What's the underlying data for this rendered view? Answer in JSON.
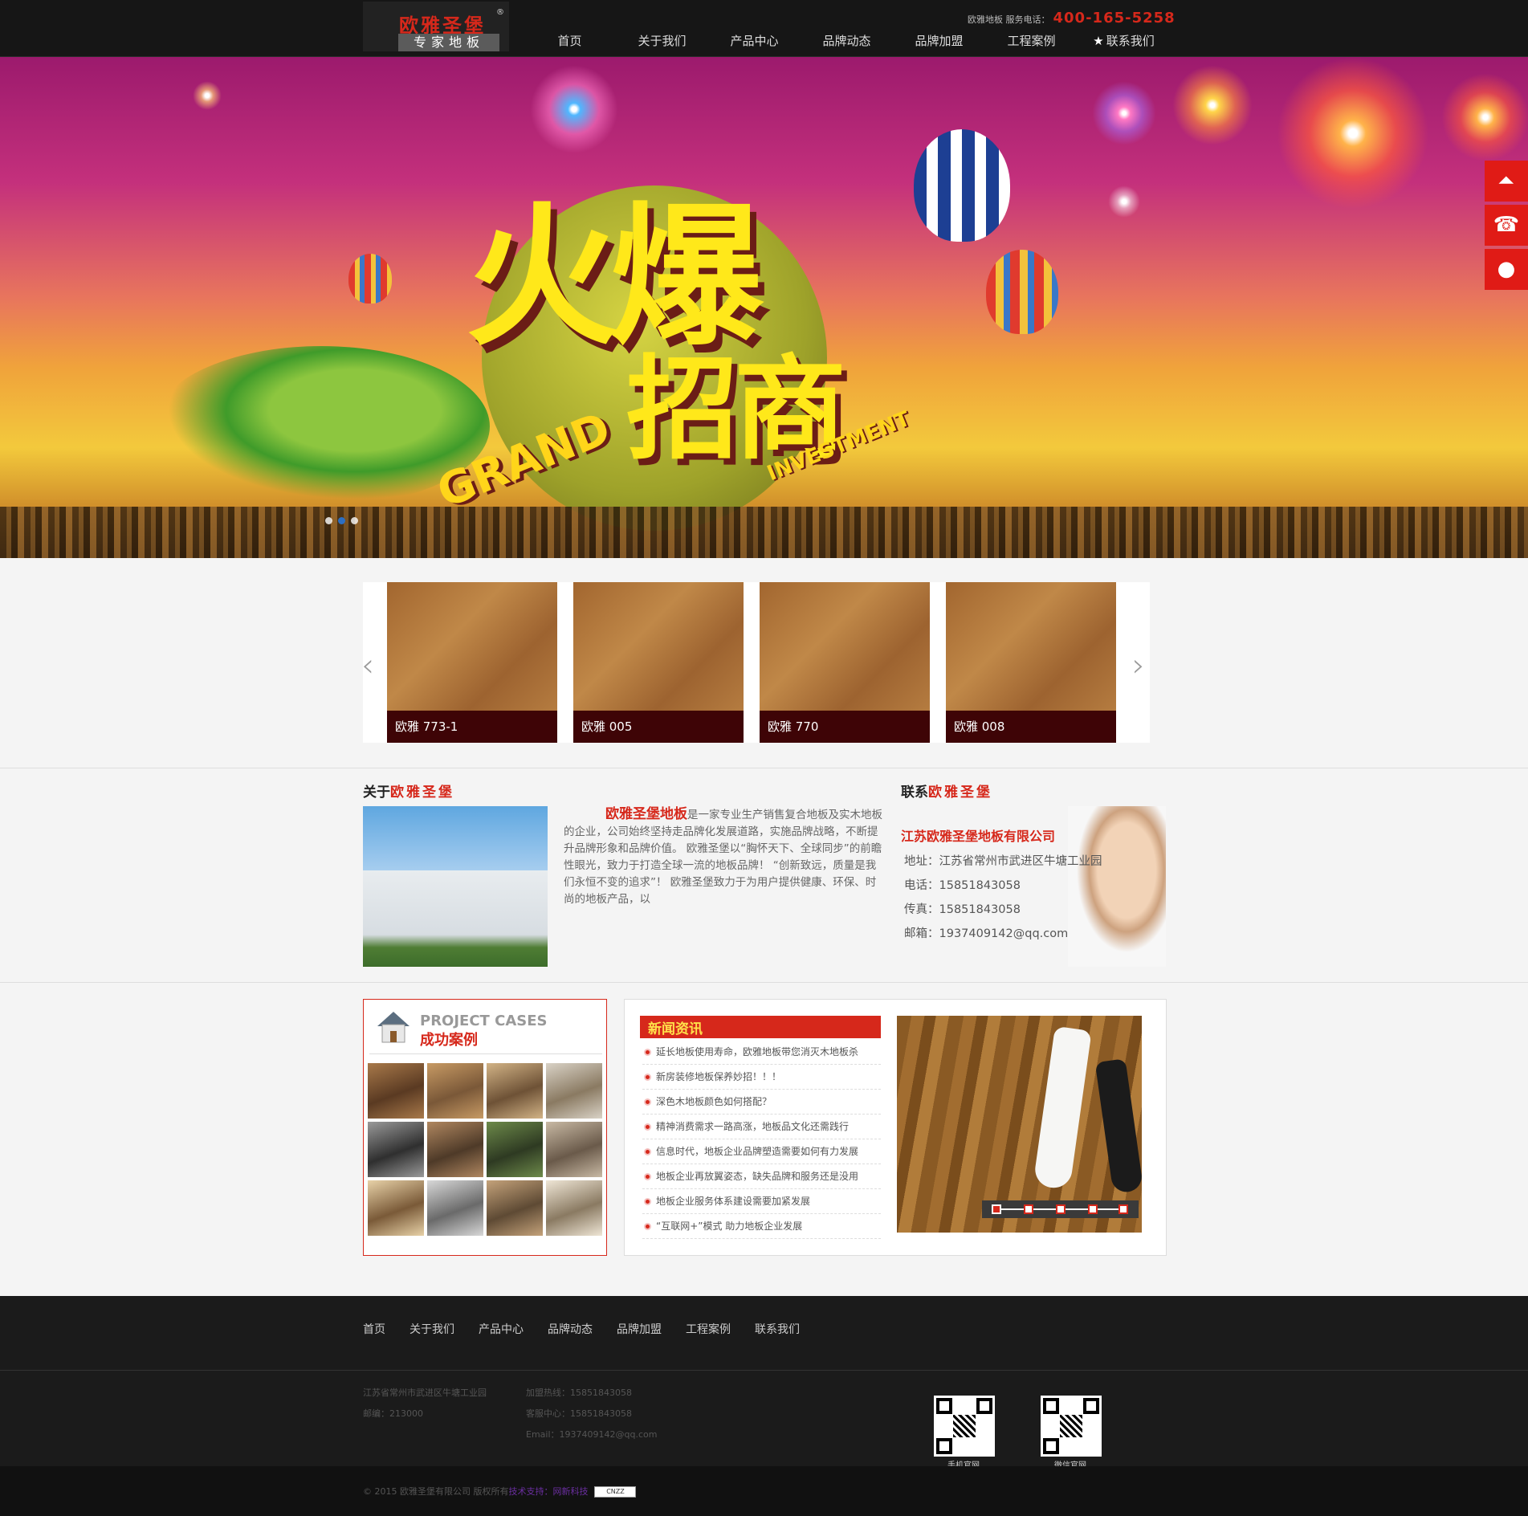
{
  "header": {
    "logo_brand": "欧雅圣堡",
    "logo_sub": "专家地板",
    "logo_reg": "®",
    "service_label": "欧雅地板 服务电话：",
    "service_tel": "400-165-5258",
    "nav": [
      "首页",
      "关于我们",
      "产品中心",
      "品牌动态",
      "品牌加盟",
      "工程案例",
      "联系我们"
    ],
    "nav_star": "★"
  },
  "banner": {
    "title_big": "火爆",
    "title_small": "招商",
    "grand": "GRAND",
    "investment": "INVESTMENT",
    "slide_count": 3,
    "active_slide": 2
  },
  "side_tools": [
    "top-icon",
    "phone-icon",
    "qq-icon"
  ],
  "products": {
    "prev": "‹",
    "next": "›",
    "items": [
      "欧雅 773-1",
      "欧雅 005",
      "欧雅 770",
      "欧雅 008"
    ]
  },
  "about": {
    "title_prefix": "关于",
    "title_brand": "欧雅圣堡",
    "brand": "欧雅圣堡地板",
    "text": "是一家专业生产销售复合地板及实木地板的企业，公司始终坚持走品牌化发展道路，实施品牌战略，不断提升品牌形象和品牌价值。 欧雅圣堡以“胸怀天下、全球同步”的前瞻性眼光，致力于打造全球一流的地板品牌！ “创新致远，质量是我们永恒不变的追求”！ 欧雅圣堡致力于为用户提供健康、环保、时尚的地板产品，以"
  },
  "contact": {
    "title_prefix": "联系",
    "title_brand": "欧雅圣堡",
    "company": "江苏欧雅圣堡地板有限公司",
    "lines": [
      "地址：江苏省常州市武进区牛塘工业园",
      "电话：15851843058",
      "传真：15851843058",
      "邮箱：1937409142@qq.com"
    ]
  },
  "cases": {
    "en": "PROJECT CASES",
    "cn": "成功案例",
    "thumb_count": 12
  },
  "news": {
    "title_a": "新闻",
    "title_b": "资讯",
    "items": [
      "延长地板使用寿命，欧雅地板带您消灭木地板杀",
      "新房装修地板保养妙招！！！",
      "深色木地板颜色如何搭配？",
      "精神消费需求一路高涨，地板品文化还需践行",
      "信息时代，地板企业品牌塑造需要如何有力发展",
      "地板企业再放翼姿态，缺失品牌和服务还是没用",
      "地板企业服务体系建设需要加紧发展",
      "“互联网+”模式 助力地板企业发展"
    ],
    "slider_dots": 5,
    "active_dot": 1
  },
  "footer": {
    "nav": [
      "首页",
      "关于我们",
      "产品中心",
      "品牌动态",
      "品牌加盟",
      "工程案例",
      "联系我们"
    ],
    "address": "江苏省常州市武进区牛塘工业园",
    "zip": "邮编：213000",
    "join_hotline": "加盟热线：15851843058",
    "service_center": "客服中心：15851843058",
    "email": "Email：1937409142@qq.com",
    "qr_labels": [
      "手机官网",
      "微信官网"
    ],
    "copyright": "© 2015 欧雅圣堡有限公司 版权所有",
    "tech_support": "技术支持：网新科技",
    "cnzz": "CNZZ"
  }
}
